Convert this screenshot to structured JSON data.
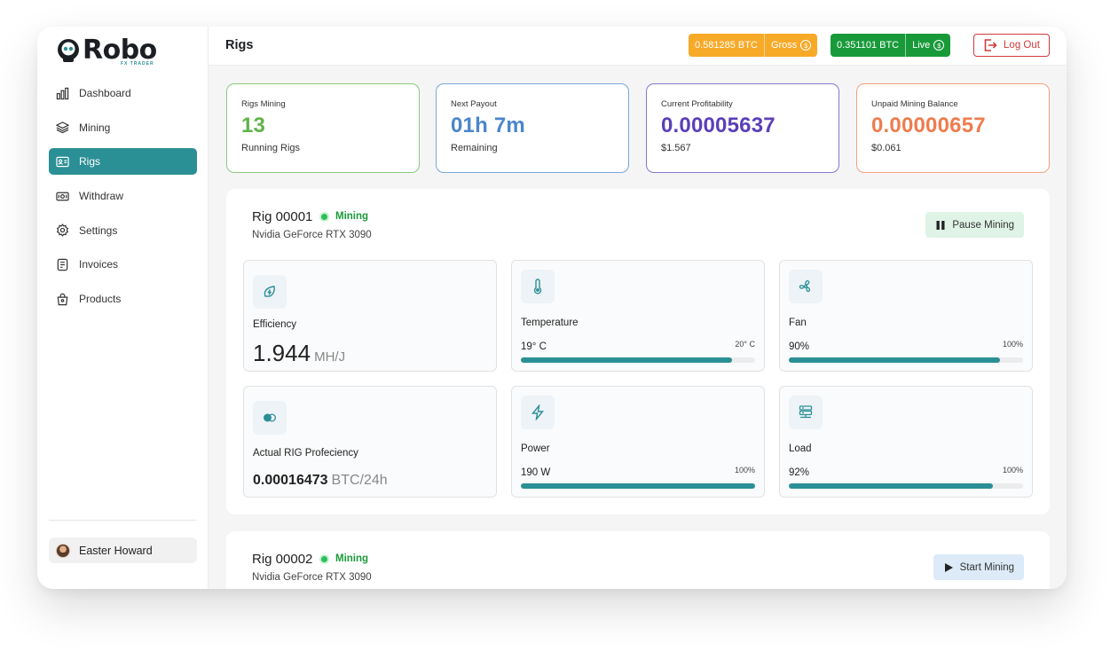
{
  "app": {
    "name": "Robo",
    "tagline": "FX TRADER"
  },
  "sidebar": {
    "items": [
      {
        "label": "Dashboard",
        "icon": "bar-chart-icon",
        "active": false
      },
      {
        "label": "Mining",
        "icon": "layers-icon",
        "active": false
      },
      {
        "label": "Rigs",
        "icon": "id-card-icon",
        "active": true
      },
      {
        "label": "Withdraw",
        "icon": "cash-icon",
        "active": false
      },
      {
        "label": "Settings",
        "icon": "gear-icon",
        "active": false
      },
      {
        "label": "Invoices",
        "icon": "invoice-icon",
        "active": false
      },
      {
        "label": "Products",
        "icon": "shopping-bag-icon",
        "active": false
      }
    ],
    "user": {
      "name": "Easter Howard"
    }
  },
  "header": {
    "title": "Rigs",
    "gross": {
      "amount": "0.581285 BTC",
      "label": "Gross"
    },
    "live": {
      "amount": "0.351101 BTC",
      "label": "Live"
    },
    "logout_label": "Log Out"
  },
  "stats": [
    {
      "label": "Rigs Mining",
      "value": "13",
      "sub": "Running Rigs",
      "color": "#5fb34a",
      "border": "#8cc97a"
    },
    {
      "label": "Next Payout",
      "value": "01h 7m",
      "sub": "Remaining",
      "color": "#4a86cc",
      "border": "#7aa7de"
    },
    {
      "label": "Current Profitability",
      "value": "0.00005637",
      "sub": "$1.567",
      "color": "#5a3fb8",
      "border": "#8a76cf"
    },
    {
      "label": "Unpaid Mining Balance",
      "value": "0.00000657",
      "sub": "$0.061",
      "color": "#ee7c4e",
      "border": "#f2a27f"
    }
  ],
  "rigs": [
    {
      "name": "Rig 00001",
      "status": "Mining",
      "model": "Nvidia GeForce RTX 3090",
      "action": "Pause Mining",
      "efficiency": {
        "label": "Efficiency",
        "value": "1.944",
        "unit": "MH/J"
      },
      "proficiency": {
        "label": "Actual RIG Profeciency",
        "value": "0.00016473",
        "unit": "BTC/24h"
      },
      "temperature": {
        "label": "Temperature",
        "value": "19° C",
        "max": "20° C",
        "fill": 0.9
      },
      "fan": {
        "label": "Fan",
        "value": "90%",
        "max": "100%",
        "fill": 0.9
      },
      "power": {
        "label": "Power",
        "value": "190 W",
        "max": "100%",
        "fill": 1.0
      },
      "load": {
        "label": "Load",
        "value": "92%",
        "max": "100%",
        "fill": 0.87
      }
    },
    {
      "name": "Rig 00002",
      "status": "Mining",
      "model": "Nvidia GeForce RTX 3090",
      "action": "Start Mining"
    }
  ],
  "colors": {
    "accent": "#2b8f96",
    "mining": "#199a3a",
    "gross": "#f7a928",
    "live": "#199a3a",
    "logout": "#d23a3a"
  }
}
